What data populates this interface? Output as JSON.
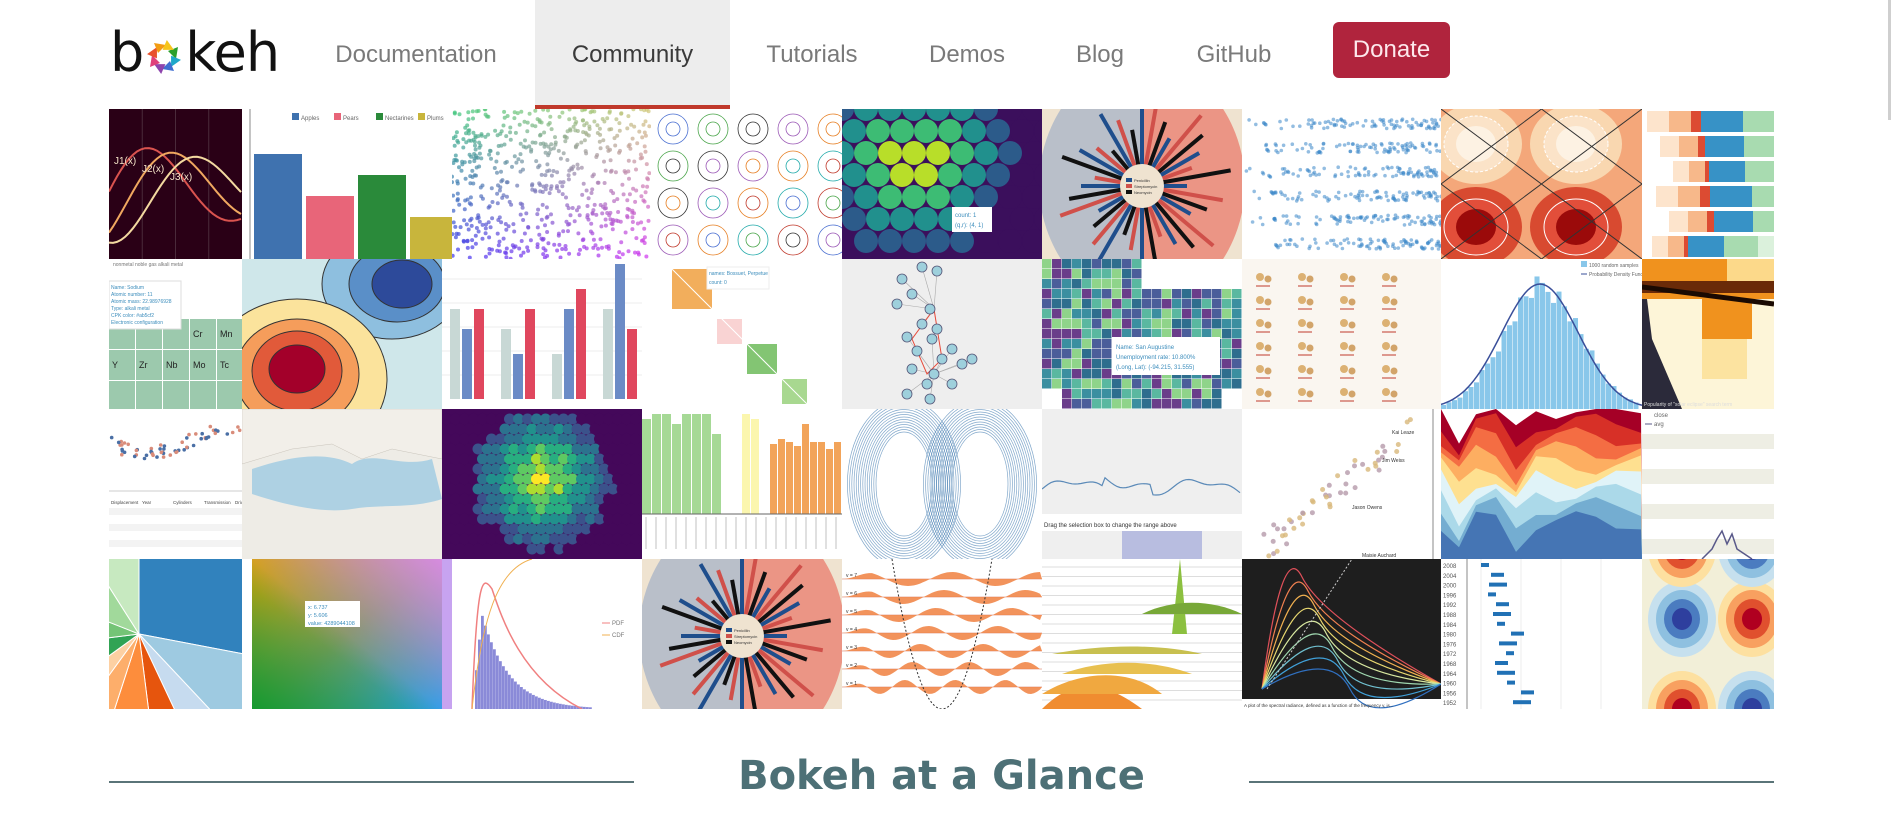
{
  "brand": {
    "name": "bokeh",
    "prefix": "b",
    "suffix": "keh"
  },
  "nav": {
    "items": [
      {
        "label": "Documentation",
        "active": false
      },
      {
        "label": "Community",
        "active": true
      },
      {
        "label": "Tutorials",
        "active": false
      },
      {
        "label": "Demos",
        "active": false
      },
      {
        "label": "Blog",
        "active": false
      },
      {
        "label": "GitHub",
        "active": false
      }
    ],
    "donate_label": "Donate"
  },
  "colors": {
    "accent": "#c0392b",
    "donate": "#b0243d",
    "heading": "#4d7076",
    "active_tab_bg": "#ededed"
  },
  "gallery": {
    "tiles": [
      {
        "name": "bessel-functions",
        "labels": [
          "J1(x)",
          "J2(x)",
          "J3(x)"
        ]
      },
      {
        "name": "fruit-bar-chart",
        "legend": [
          "Apples",
          "Pears",
          "Nectarines",
          "Plums"
        ]
      },
      {
        "name": "color-scatter"
      },
      {
        "name": "glyph-rose-curves"
      },
      {
        "name": "hexbin-tooltip",
        "tooltip": [
          "count: 1",
          "(q,r): (4, 1)"
        ]
      },
      {
        "name": "burtin-radial-bars",
        "legend": [
          "Penicillin",
          "Streptomycin",
          "Neomycin"
        ]
      },
      {
        "name": "jitter-scatter"
      },
      {
        "name": "contour-diamonds"
      },
      {
        "name": "stacked-horizontal-bars"
      },
      {
        "name": "periodic-table",
        "legend": [
          "nonmetal",
          "noble gas",
          "alkali metal"
        ],
        "tooltip": [
          "Name: Sodium",
          "Atomic number: 11",
          "Atomic mass: 22.98976928",
          "Type: alkali metal",
          "CPK color: #ab5cf2",
          "Electronic configuration: [Ne] 3s1"
        ],
        "cells": [
          "Cr",
          "Mn",
          "Y",
          "Zr",
          "Nb",
          "Mo",
          "Tc"
        ]
      },
      {
        "name": "filled-contours"
      },
      {
        "name": "grouped-vbars"
      },
      {
        "name": "les-mis-matrix",
        "tooltip": [
          "names: Bossuet, Perpetue",
          "count: 0"
        ]
      },
      {
        "name": "network-graph"
      },
      {
        "name": "texas-unemployment",
        "tooltip": [
          "Name: San Augustine",
          "Unemployment rate: 10.800%",
          "(Long, Lat): (-94.215, 31.555)"
        ]
      },
      {
        "name": "marker-types"
      },
      {
        "name": "histogram-pdf",
        "legend": [
          "1000 random samples",
          "Probability Density Function"
        ]
      },
      {
        "name": "choropleth-west",
        "caption": "Popularity of \"solar eclipse\" search term"
      },
      {
        "name": "auto-mpg-scatter-table",
        "columns": [
          "Displacement",
          "Year",
          "Cylinders",
          "Transmission",
          "Drive"
        ]
      },
      {
        "name": "tile-map-mediterranean"
      },
      {
        "name": "hexbin-viridis"
      },
      {
        "name": "grouped-categorical-bars"
      },
      {
        "name": "lorenz-attractor"
      },
      {
        "name": "range-tool",
        "caption": "Drag the selection box to change the range above"
      },
      {
        "name": "labeled-scatter",
        "labels": [
          "Kai Leaze",
          "Jim Weiss",
          "Jason Owens",
          "Maisie Auchard"
        ]
      },
      {
        "name": "stacked-area"
      },
      {
        "name": "stock-close-avg",
        "legend": [
          "close",
          "avg"
        ]
      },
      {
        "name": "pie-chart"
      },
      {
        "name": "color-gradient-image",
        "tooltip": [
          "x: 6.737",
          "y: 5.606",
          "value: 4289044108"
        ]
      },
      {
        "name": "pdf-cdf-histogram",
        "legend": [
          "PDF",
          "CDF"
        ]
      },
      {
        "name": "burtin-radial-bars-2",
        "legend": [
          "Penicillin",
          "Streptomycin",
          "Neomycin"
        ]
      },
      {
        "name": "quantum-oscillator",
        "labels": [
          "v = 7",
          "v = 6",
          "v = 5",
          "v = 4",
          "v = 3",
          "v = 2",
          "v = 1"
        ]
      },
      {
        "name": "ridgeplot"
      },
      {
        "name": "blackbody-radiation",
        "caption": "A plot of the spectral radiance, defined as a function of the frequency v, is..."
      },
      {
        "name": "olympic-sprint-timeline",
        "years": [
          "2008",
          "2004",
          "2000",
          "1996",
          "1992",
          "1988",
          "1984",
          "1980",
          "1976",
          "1972",
          "1968",
          "1964",
          "1960",
          "1956",
          "1952"
        ]
      },
      {
        "name": "image-contours"
      }
    ]
  },
  "section": {
    "title": "Bokeh at a Glance"
  }
}
